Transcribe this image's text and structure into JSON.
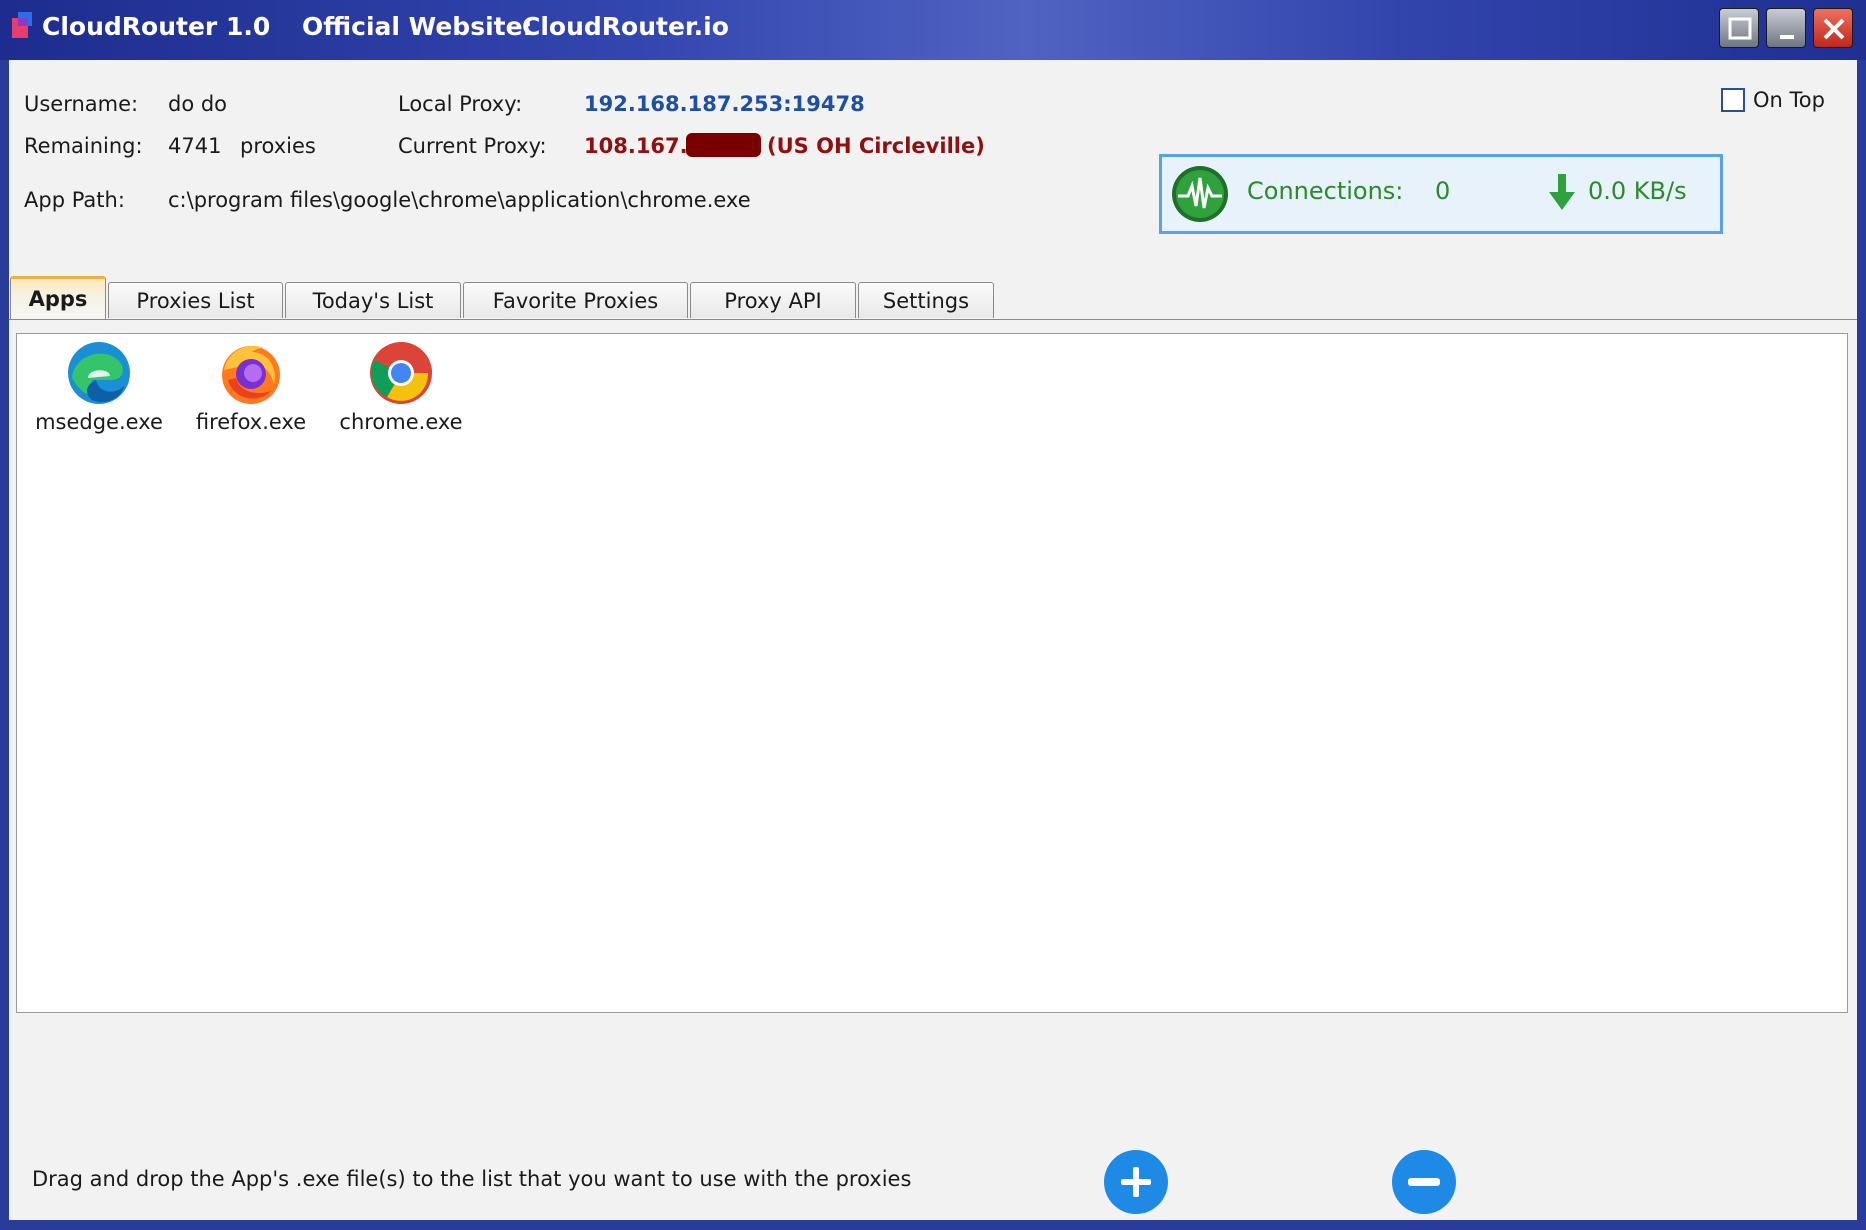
{
  "window": {
    "title": "CloudRouter 1.0",
    "website_label": "Official Website:",
    "website_url": "CloudRouter.io"
  },
  "info": {
    "username_label": "Username:",
    "username_value": "do do",
    "remaining_label": "Remaining:",
    "remaining_value": "4741",
    "remaining_unit": "proxies",
    "local_proxy_label": "Local Proxy:",
    "local_proxy_value": "192.168.187.253:19478",
    "current_proxy_label": "Current Proxy:",
    "current_proxy_prefix": "108.167.",
    "current_proxy_location": "(US OH Circleville)",
    "app_path_label": "App Path:",
    "app_path_value": "c:\\program files\\google\\chrome\\application\\chrome.exe"
  },
  "on_top": {
    "label": "On Top",
    "checked": false
  },
  "status": {
    "connections_label": "Connections:",
    "connections_value": "0",
    "speed_value": "0.0 KB/s"
  },
  "tabs": [
    {
      "label": "Apps",
      "active": true
    },
    {
      "label": "Proxies List",
      "active": false
    },
    {
      "label": "Today's List",
      "active": false
    },
    {
      "label": "Favorite Proxies",
      "active": false
    },
    {
      "label": "Proxy API",
      "active": false
    },
    {
      "label": "Settings",
      "active": false
    }
  ],
  "apps": [
    {
      "name": "msedge.exe",
      "icon": "edge-icon"
    },
    {
      "name": "firefox.exe",
      "icon": "firefox-icon"
    },
    {
      "name": "chrome.exe",
      "icon": "chrome-icon"
    }
  ],
  "footer": {
    "hint": "Drag and drop the App's .exe file(s) to the list that you want to use with the proxies"
  },
  "colors": {
    "title_bar": "#3347b0",
    "accent_blue": "#1e8ae6",
    "status_green": "#2b8a2b",
    "proxy_red": "#8e1010",
    "proxy_blue": "#1f4fa0"
  }
}
